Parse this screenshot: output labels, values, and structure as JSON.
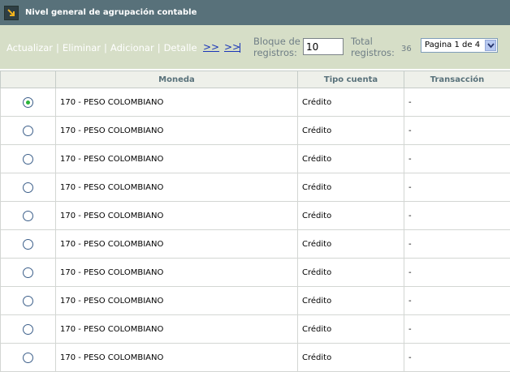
{
  "header": {
    "title": "Nivel general de agrupación contable",
    "icon": "arrow-down-right-icon"
  },
  "toolbar": {
    "actions": [
      {
        "label": "Actualizar"
      },
      {
        "label": "Eliminar"
      },
      {
        "label": "Adicionar"
      },
      {
        "label": "Detalle"
      }
    ],
    "separator": "|",
    "next_label": ">>",
    "last_label": ">>",
    "bloque_label_line1": "Bloque de",
    "bloque_label_line2": "registros:",
    "bloque_value": "10",
    "total_label_line1": "Total",
    "total_label_line2": "registros:",
    "total_value": "36",
    "page_selected": "Pagina 1 de 4"
  },
  "table": {
    "columns": [
      "",
      "Moneda",
      "Tipo cuenta",
      "Transacción"
    ],
    "rows": [
      {
        "selected": true,
        "moneda": "170 - PESO COLOMBIANO",
        "tipo": "Crédito",
        "transaccion": "-"
      },
      {
        "selected": false,
        "moneda": "170 - PESO COLOMBIANO",
        "tipo": "Crédito",
        "transaccion": "-"
      },
      {
        "selected": false,
        "moneda": "170 - PESO COLOMBIANO",
        "tipo": "Crédito",
        "transaccion": "-"
      },
      {
        "selected": false,
        "moneda": "170 - PESO COLOMBIANO",
        "tipo": "Crédito",
        "transaccion": "-"
      },
      {
        "selected": false,
        "moneda": "170 - PESO COLOMBIANO",
        "tipo": "Crédito",
        "transaccion": "-"
      },
      {
        "selected": false,
        "moneda": "170 - PESO COLOMBIANO",
        "tipo": "Crédito",
        "transaccion": "-"
      },
      {
        "selected": false,
        "moneda": "170 - PESO COLOMBIANO",
        "tipo": "Crédito",
        "transaccion": "-"
      },
      {
        "selected": false,
        "moneda": "170 - PESO COLOMBIANO",
        "tipo": "Crédito",
        "transaccion": "-"
      },
      {
        "selected": false,
        "moneda": "170 - PESO COLOMBIANO",
        "tipo": "Crédito",
        "transaccion": "-"
      },
      {
        "selected": false,
        "moneda": "170 - PESO COLOMBIANO",
        "tipo": "Crédito",
        "transaccion": "-"
      }
    ]
  },
  "colors": {
    "titlebar": "#58717a",
    "toolbar": "#d6dec7",
    "link": "#1a36b8",
    "header_text": "#58717a",
    "radio_selected": "#2bb53a"
  }
}
